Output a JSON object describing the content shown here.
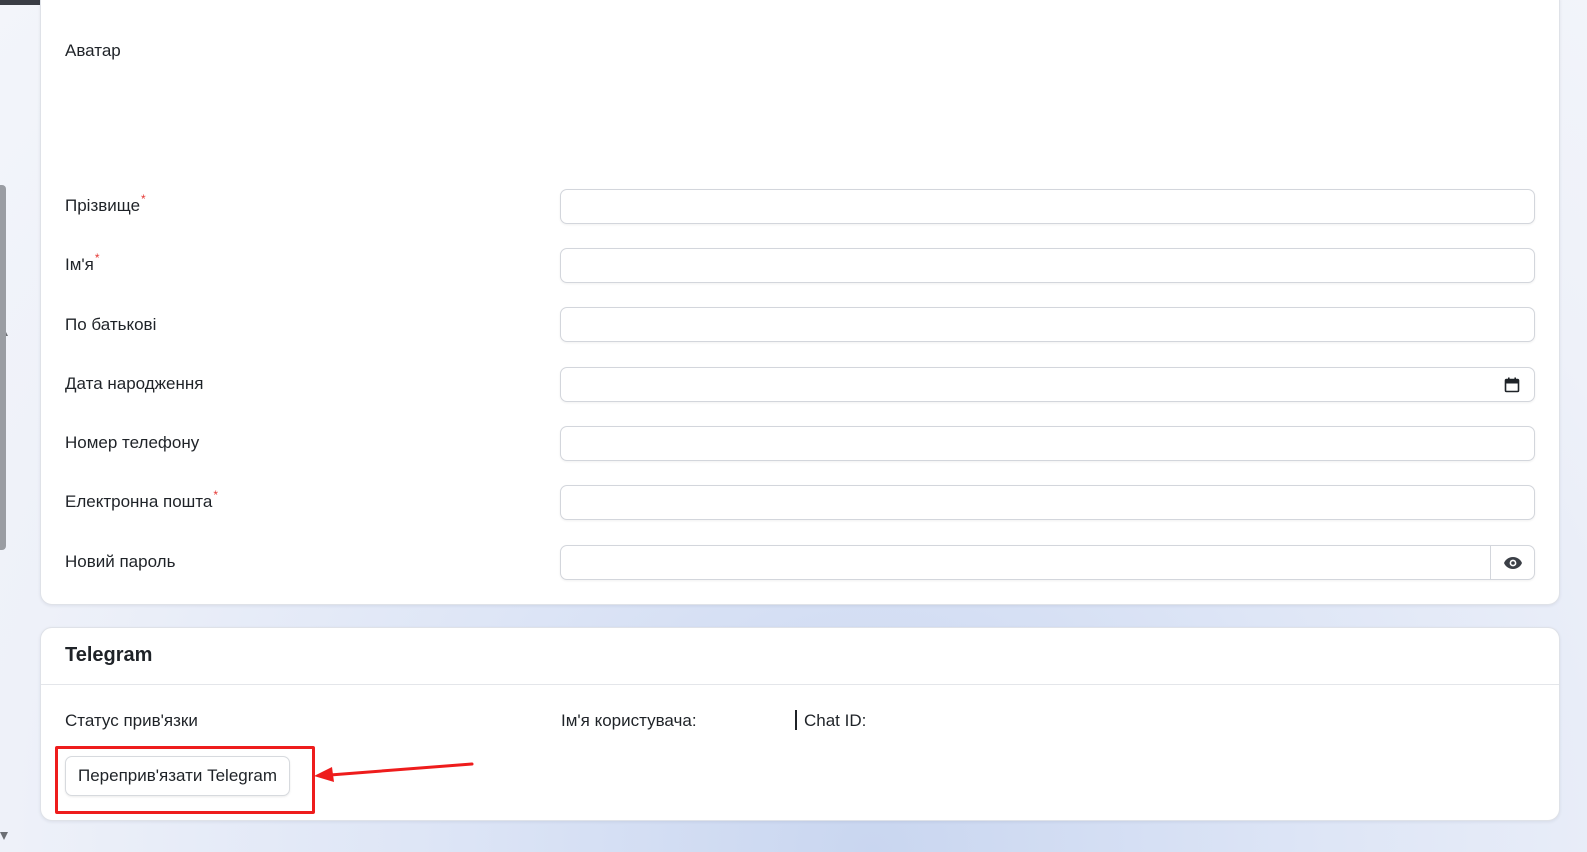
{
  "profile": {
    "avatar_label": "Аватар",
    "fields": {
      "last_name": {
        "label": "Прізвище",
        "required_mark": "*",
        "value": ""
      },
      "first_name": {
        "label": "Ім'я",
        "required_mark": "*",
        "value": ""
      },
      "patronymic": {
        "label": "По батькові",
        "value": ""
      },
      "birth_date": {
        "label": "Дата народження",
        "value": "",
        "icon": "calendar-icon"
      },
      "phone": {
        "label": "Номер телефону",
        "value": ""
      },
      "email": {
        "label": "Електронна пошта",
        "required_mark": "*",
        "value": ""
      },
      "password": {
        "label": "Новий пароль",
        "value": "",
        "toggle_icon": "eye-icon"
      }
    }
  },
  "telegram": {
    "title": "Telegram",
    "status_label": "Статус прив'язки",
    "username_label": "Ім'я користувача:",
    "chat_id_label": "Chat ID:",
    "rebind_button": "Переприв'язати Telegram"
  },
  "annotation": {
    "highlight_color": "#ee1c1c"
  },
  "colors": {
    "required": "#e53935",
    "border": "#d3d6dc"
  }
}
